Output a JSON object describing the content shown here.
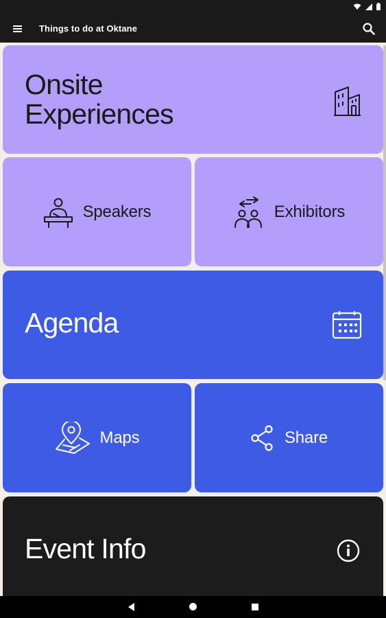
{
  "app": {
    "title": "Things to do at Oktane"
  },
  "colors": {
    "lavender": "#b49efc",
    "blue": "#3d5be4",
    "dark": "#1c1c1c"
  },
  "cards": {
    "onsite": {
      "line1": "Onsite",
      "line2": "Experiences",
      "icon": "buildings-icon"
    },
    "speakers": {
      "label": "Speakers",
      "icon": "podium-speaker-icon"
    },
    "exhibitors": {
      "label": "Exhibitors",
      "icon": "people-group-icon"
    },
    "agenda": {
      "label": "Agenda",
      "icon": "calendar-icon"
    },
    "maps": {
      "label": "Maps",
      "icon": "map-pin-icon"
    },
    "share": {
      "label": "Share",
      "icon": "share-icon"
    },
    "event_info": {
      "label": "Event Info",
      "icon": "info-icon"
    }
  }
}
